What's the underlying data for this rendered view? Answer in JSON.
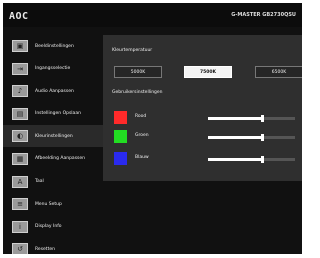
{
  "header": {
    "logo": "AOC",
    "model": "G-MASTER GB2730QSU"
  },
  "sidebar": {
    "items": [
      {
        "label": "Beeldinstellingen",
        "icon": "display-icon"
      },
      {
        "label": "Ingangsselectie",
        "icon": "input-icon"
      },
      {
        "label": "Audio Aanpassen",
        "icon": "audio-icon"
      },
      {
        "label": "Instellingen Opslaan",
        "icon": "save-icon"
      },
      {
        "label": "Kleurinstellingen",
        "icon": "color-settings-icon"
      },
      {
        "label": "Afbeelding Aanpassen",
        "icon": "picture-adjust-icon"
      },
      {
        "label": "Taal",
        "icon": "language-icon"
      },
      {
        "label": "Menu Setup",
        "icon": "menu-setup-icon"
      },
      {
        "label": "Display Info",
        "icon": "info-icon"
      },
      {
        "label": "Resetten",
        "icon": "reset-icon"
      }
    ]
  },
  "panel": {
    "color_temp_title": "Kleurtemperatuur",
    "temps": [
      "5000K",
      "7500K",
      "6500K"
    ],
    "selected_temp": "7500K",
    "user_settings_title": "Gebruikersinstellingen",
    "channels": [
      {
        "label": "Rood",
        "color": "#ff2a2a",
        "level_pct": 62
      },
      {
        "label": "Groen",
        "color": "#22dd22",
        "level_pct": 62
      },
      {
        "label": "Blauw",
        "color": "#2a2aee",
        "level_pct": 62
      }
    ]
  }
}
